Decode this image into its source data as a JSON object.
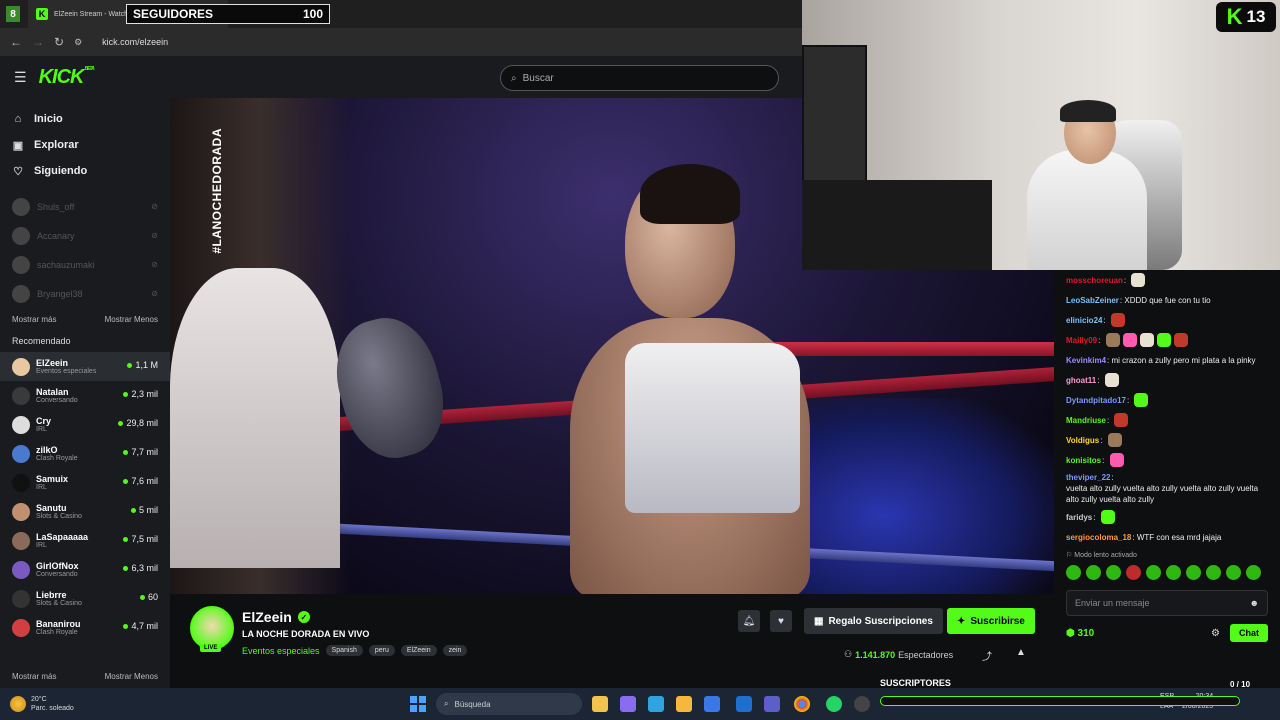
{
  "browser": {
    "tab_number": "8",
    "tab_title": "ElZeein Stream - Watch",
    "url": "kick.com/elzeein"
  },
  "followers_overlay": {
    "label": "SEGUIDORES",
    "count": "100"
  },
  "kick": {
    "logo": "KICK",
    "logo_beta": "BETA",
    "search_placeholder": "Buscar"
  },
  "sidebar": {
    "nav": [
      {
        "label": "Inicio",
        "icon": "home-icon"
      },
      {
        "label": "Explorar",
        "icon": "compass-icon"
      },
      {
        "label": "Siguiendo",
        "icon": "heart-icon"
      }
    ],
    "offline_channels": [
      "Shuls_off",
      "Accanary",
      "sachauzumaki",
      "Bryangel38"
    ],
    "show_more": "Mostrar más",
    "show_less": "Mostrar Menos",
    "recommended_title": "Recomendado",
    "recommended": [
      {
        "name": "ElZeein",
        "category": "Eventos especiales",
        "viewers": "1,1 M",
        "color": "#e8c8a0",
        "active": true
      },
      {
        "name": "Natalan",
        "category": "Conversando",
        "viewers": "2,3 mil",
        "color": "#3a3a3a",
        "active": false
      },
      {
        "name": "Cry",
        "category": "IRL",
        "viewers": "29,8 mil",
        "color": "#dddddd",
        "active": false
      },
      {
        "name": "zilkO",
        "category": "Clash Royale",
        "viewers": "7,7 mil",
        "color": "#4a7ad0",
        "active": false
      },
      {
        "name": "Samuix",
        "category": "IRL",
        "viewers": "7,6 mil",
        "color": "#111111",
        "active": false
      },
      {
        "name": "Sanutu",
        "category": "Slots & Casino",
        "viewers": "5 mil",
        "color": "#c09070",
        "active": false
      },
      {
        "name": "LaSapaaaaa",
        "category": "IRL",
        "viewers": "7,5 mil",
        "color": "#8a6a5a",
        "active": false
      },
      {
        "name": "GirlOfNox",
        "category": "Conversando",
        "viewers": "6,3 mil",
        "color": "#7a5ac0",
        "active": false
      },
      {
        "name": "Liebrre",
        "category": "Slots & Casino",
        "viewers": "60",
        "color": "#333333",
        "active": false
      },
      {
        "name": "Bananirou",
        "category": "Clash Royale",
        "viewers": "4,7 mil",
        "color": "#d04040",
        "active": false
      }
    ]
  },
  "video": {
    "hashtag": "#LANOCHEDORADA"
  },
  "cam_badge": {
    "logo": "K",
    "number": "13"
  },
  "chat": {
    "messages": [
      {
        "user": "mosschoreuan",
        "color": "#e0182c",
        "text": "",
        "emotes": 1
      },
      {
        "user": "LeoSabZeiner",
        "color": "#7ac0ff",
        "text": "XDDD que fue con tu tio",
        "emotes": 0
      },
      {
        "user": "elinicio24",
        "color": "#7ac0ff",
        "text": "",
        "emotes": 1
      },
      {
        "user": "Mailly09",
        "color": "#e0182c",
        "text": "",
        "emotes": 5
      },
      {
        "user": "Kevinkim4",
        "color": "#a08aff",
        "text": "mi crazon a zully pero mi plata a la pinky",
        "emotes": 0
      },
      {
        "user": "ghoat11",
        "color": "#ff9ad6",
        "text": "",
        "emotes": 1
      },
      {
        "user": "Dytandpitado17",
        "color": "#7a9aff",
        "text": "",
        "emotes": 1
      },
      {
        "user": "Mandriuse",
        "color": "#53fc18",
        "text": "",
        "emotes": 1
      },
      {
        "user": "Voldigus",
        "color": "#ffd83a",
        "text": "",
        "emotes": 1
      },
      {
        "user": "konisitos",
        "color": "#53fc18",
        "text": "",
        "emotes": 1
      },
      {
        "user": "theviper_22",
        "color": "#7a9aff",
        "text": "vuelta alto zully vuelta alto zully vuelta alto zully vuelta alto zully vuelta alto zully",
        "emotes": 0
      },
      {
        "user": "faridys",
        "color": "#cccccc",
        "text": "",
        "emotes": 1
      },
      {
        "user": "sergiocoloma_18",
        "color": "#ff9a3a",
        "text": "WTF con esa mrd jajaja",
        "emotes": 0
      }
    ],
    "slow_mode": "Modo lento activado",
    "input_placeholder": "Enviar un mensaje",
    "points": "310",
    "chat_button": "Chat"
  },
  "stream": {
    "name": "ElZeein",
    "live_label": "LIVE",
    "title": "LA NOCHE DORADA EN VIVO",
    "category": "Eventos especiales",
    "tags": [
      "Spanish",
      "peru",
      "ElZeein",
      "zein"
    ],
    "gift_label": "Regalo Suscripciones",
    "subscribe_label": "Suscribirse",
    "viewers": "1.141.870",
    "viewers_label": "Espectadores"
  },
  "subs_overlay": {
    "label": "SUSCRIPTORES",
    "counter": "0 / 10",
    "progress": 0
  },
  "taskbar": {
    "temp": "20°C",
    "weather": "Parc. soleado",
    "search_placeholder": "Búsqueda",
    "lang": "ESP",
    "lang2": "LAA",
    "time": "20:34",
    "date": "2/08/2025"
  },
  "colors": {
    "accent": "#53fc18",
    "background": "#0d0f11",
    "sidebar": "#191b1f"
  }
}
